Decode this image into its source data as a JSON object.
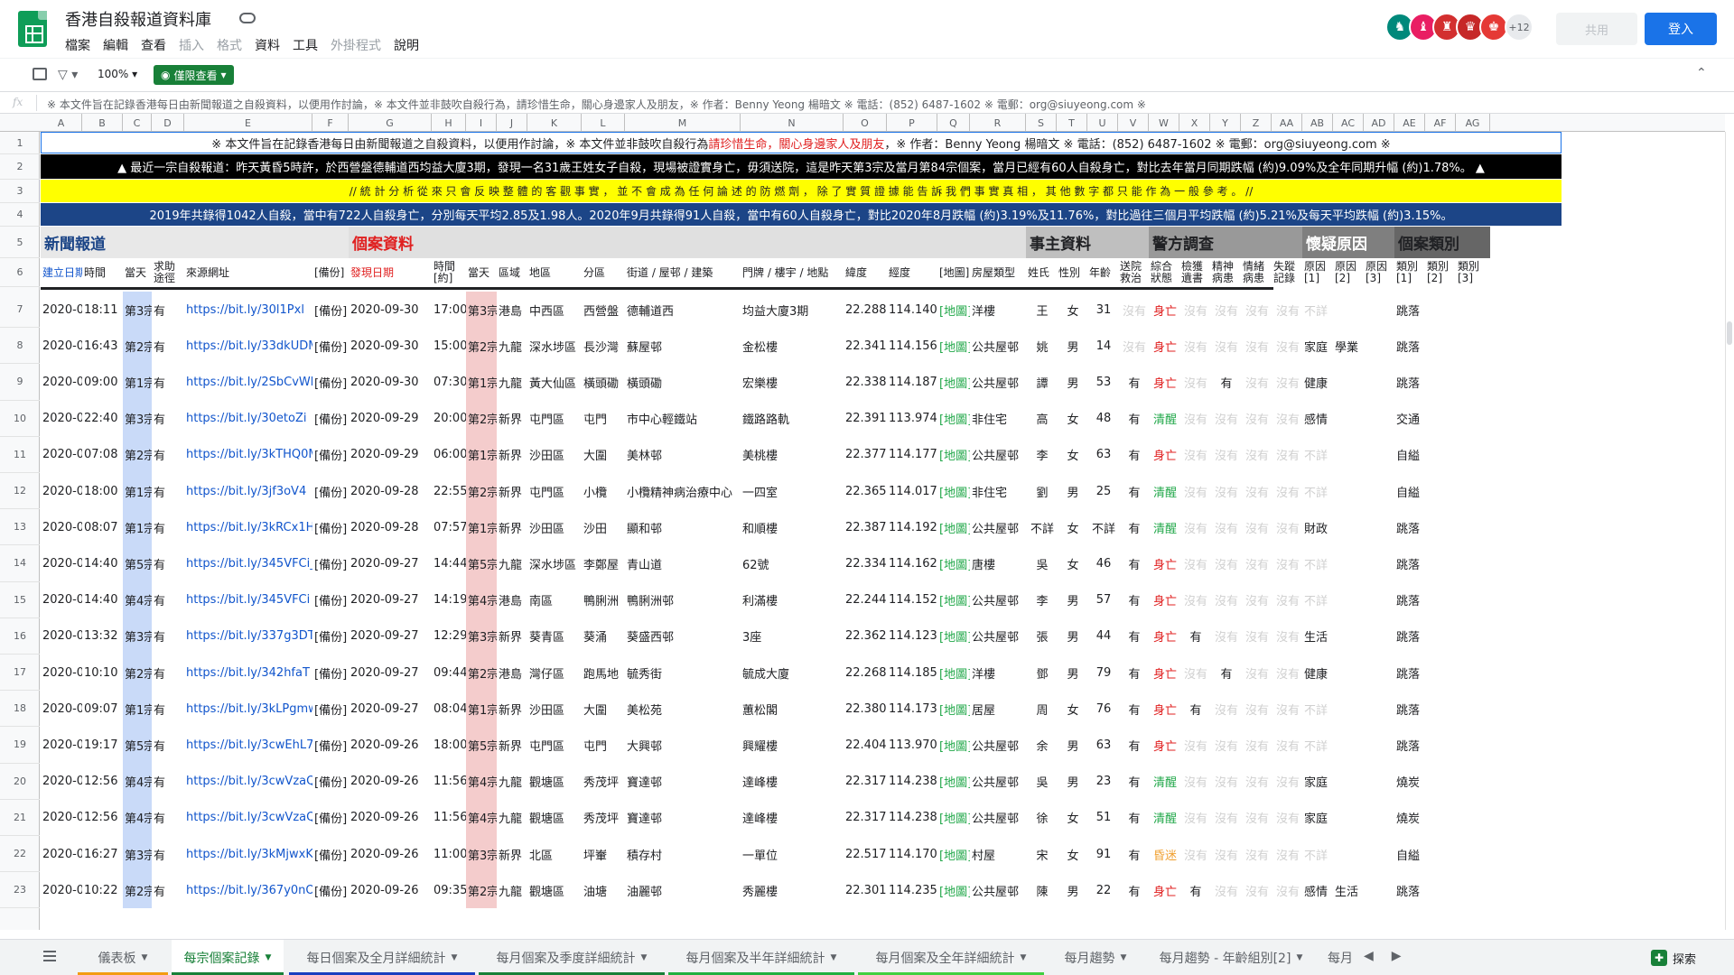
{
  "app": {
    "title": "香港自殺報道資料庫",
    "menu": [
      {
        "label": "檔案",
        "enabled": true
      },
      {
        "label": "編輯",
        "enabled": true
      },
      {
        "label": "查看",
        "enabled": true
      },
      {
        "label": "插入",
        "enabled": false
      },
      {
        "label": "格式",
        "enabled": false
      },
      {
        "label": "資料",
        "enabled": true
      },
      {
        "label": "工具",
        "enabled": true
      },
      {
        "label": "外掛程式",
        "enabled": false
      },
      {
        "label": "說明",
        "enabled": true
      }
    ],
    "collaborators_more": "+12",
    "share_label": "共用",
    "login_label": "登入"
  },
  "toolbar": {
    "zoom": "100%",
    "view_mode": "僅限查看"
  },
  "formula_bar": {
    "icon": "fx",
    "content": "※ 本文件旨在記錄香港每日由新聞報道之自殺資料，以便用作討論，※ 本文件並非鼓吹自殺行為，請珍惜生命，關心身邊家人及朋友，※ 作者：Benny Yeong 楊暗文 ※ 電話：(852) 6487-1602 ※ 電郵：org@siuyeong.com ※"
  },
  "columns": [
    "A",
    "B",
    "C",
    "D",
    "E",
    "F",
    "G",
    "H",
    "I",
    "J",
    "K",
    "L",
    "M",
    "N",
    "O",
    "P",
    "Q",
    "R",
    "S",
    "T",
    "U",
    "V",
    "W",
    "X",
    "Y",
    "Z",
    "AA",
    "AB",
    "AC",
    "AD",
    "AE",
    "AF",
    "AG"
  ],
  "banners": {
    "row1": {
      "a": "※ 本文件旨在記錄香港每日由新聞報道之自殺資料，以便用作討論，※ 本文件並非鼓吹自殺行為 ",
      "b": "請珍惜生命，關心身邊家人及朋友",
      "c": "，※ 作者：Benny Yeong 楊暗文 ※ 電話：(852) 6487-1602 ※ 電郵：org@siuyeong.com ※"
    },
    "row2": "▲ 最近一宗自殺報道：昨天黃昏5時許，於西營盤德輔道西均益大廈3期，發現一名31歲王姓女子自殺，現場被證實身亡，毋須送院，這是昨天第3宗及當月第84宗個案，當月已經有60人自殺身亡，對比去年當月同期跌幅 (約)9.09%及全年同期升幅 (約)1.78%。 ▲",
    "row3": "// 統 計 分 析 從 來 只 會 反 映 整 體 的 客 觀 事 實 ， 並 不 會 成 為 任 何 論 述 的 防 燃 劑 ， 除 了 實 質 證 據 能 告 訴 我 們 事 實 真 相 ， 其 他 數 字 都 只 能 作 為 一 般 參 考 。 //",
    "row4": "2019年共錄得1042人自殺，當中有722人自殺身亡，分別每天平均2.85及1.98人。2020年9月共錄得91人自殺，當中有60人自殺身亡，對比2020年8月跌幅 (約)3.19%及11.76%，對比過往三個月平均跌幅 (約)5.21%及每天平均跌幅 (約)3.15%。"
  },
  "sections": {
    "news": "新聞報道",
    "case": "個案資料",
    "person": "事主資料",
    "police": "警方調查",
    "suspect": "懷疑原因",
    "category": "個案類別"
  },
  "headers": {
    "build_date": "建立日期",
    "time": "時間",
    "day": "當天",
    "help": "求助\n途徑",
    "url": "來源網址",
    "backup": "[備份]",
    "found_date": "發現日期",
    "found_time": "時間\n[約]",
    "day2": "當天",
    "region": "區域",
    "district": "地區",
    "subdistrict": "分區",
    "street": "街道 / 屋邨 / 建築",
    "building": "門牌 / 樓宇 / 地點",
    "lat": "緯度",
    "lng": "經度",
    "map": "[地圖]",
    "housing": "房屋類型",
    "surname": "姓氏",
    "gender": "性別",
    "age": "年齡",
    "rescue": "送院\n救治",
    "status": "綜合\n狀態",
    "record": "檢獲\n遺書",
    "mental": "精神\n病患",
    "emotion": "情緒\n病患",
    "missing": "失蹤\n記錄",
    "reason1": "原因\n[1]",
    "reason2": "原因\n[2]",
    "reason3": "原因\n[3]",
    "cat1": "類別\n[1]",
    "cat2": "類別\n[2]",
    "cat3": "類別\n[3]"
  },
  "rows": [
    {
      "n": "7",
      "date": "2020-09-30",
      "time": "18:11",
      "day": "第3宗",
      "help": "有",
      "url": "https://bit.ly/30l1Pxl",
      "bk": "[備份]",
      "fdate": "2020-09-30",
      "ftime": "17:00",
      "fday": "第3宗",
      "region": "港島",
      "district": "中西區",
      "sub": "西營盤",
      "street": "德輔道西",
      "bldg": "均益大廈3期",
      "lat": "22.2882",
      "lng": "114.1404",
      "map": "[地圖]",
      "house": "洋樓",
      "sur": "王",
      "sex": "女",
      "age": "31",
      "rescue": "沒有",
      "status": "身亡",
      "status_c": "red",
      "note": "沒有",
      "mental": "沒有",
      "emo": "沒有",
      "miss": "沒有",
      "r1": "不詳",
      "r2": "",
      "cat": "跳落"
    },
    {
      "n": "8",
      "date": "2020-09-30",
      "time": "16:43",
      "day": "第2宗",
      "help": "有",
      "url": "https://bit.ly/33dkUDM",
      "bk": "[備份]",
      "fdate": "2020-09-30",
      "ftime": "15:00",
      "fday": "第2宗",
      "region": "九龍",
      "district": "深水埗區",
      "sub": "長沙灣",
      "street": "蘇屋邨",
      "bldg": "金松樓",
      "lat": "22.3414",
      "lng": "114.1560",
      "map": "[地圖]",
      "house": "公共屋邨",
      "sur": "姚",
      "sex": "男",
      "age": "14",
      "rescue": "沒有",
      "status": "身亡",
      "status_c": "red",
      "note": "沒有",
      "mental": "沒有",
      "emo": "沒有",
      "miss": "沒有",
      "r1": "家庭",
      "r2": "學業",
      "cat": "跳落"
    },
    {
      "n": "9",
      "date": "2020-09-30",
      "time": "09:00",
      "day": "第1宗",
      "help": "有",
      "url": "https://bit.ly/2SbCvWb",
      "bk": "[備份]",
      "fdate": "2020-09-30",
      "ftime": "07:30",
      "fday": "第1宗",
      "region": "九龍",
      "district": "黃大仙區",
      "sub": "橫頭磡",
      "street": "橫頭磡",
      "bldg": "宏樂樓",
      "lat": "22.3388",
      "lng": "114.1879",
      "map": "[地圖]",
      "house": "公共屋邨",
      "sur": "譚",
      "sex": "男",
      "age": "53",
      "rescue": "有",
      "status": "身亡",
      "status_c": "red",
      "note": "沒有",
      "mental": "有",
      "emo": "沒有",
      "miss": "沒有",
      "r1": "健康",
      "r2": "",
      "cat": "跳落"
    },
    {
      "n": "10",
      "date": "2020-09-29",
      "time": "22:40",
      "day": "第3宗",
      "help": "有",
      "url": "https://bit.ly/30etoZi",
      "bk": "[備份]",
      "fdate": "2020-09-29",
      "ftime": "20:00",
      "fday": "第2宗",
      "region": "新界",
      "district": "屯門區",
      "sub": "屯門",
      "street": "市中心輕鐵站",
      "bldg": "鐵路路軌",
      "lat": "22.3914",
      "lng": "113.9749",
      "map": "[地圖]",
      "house": "非住宅",
      "sur": "高",
      "sex": "女",
      "age": "48",
      "rescue": "有",
      "status": "清醒",
      "status_c": "green",
      "note": "沒有",
      "mental": "沒有",
      "emo": "沒有",
      "miss": "沒有",
      "r1": "感情",
      "r2": "",
      "cat": "交通"
    },
    {
      "n": "11",
      "date": "2020-09-29",
      "time": "07:08",
      "day": "第2宗",
      "help": "有",
      "url": "https://bit.ly/3kTHQ0M",
      "bk": "[備份]",
      "fdate": "2020-09-29",
      "ftime": "06:00",
      "fday": "第1宗",
      "region": "新界",
      "district": "沙田區",
      "sub": "大圍",
      "street": "美林邨",
      "bldg": "美桃樓",
      "lat": "22.3777",
      "lng": "114.1773",
      "map": "[地圖]",
      "house": "公共屋邨",
      "sur": "李",
      "sex": "女",
      "age": "63",
      "rescue": "有",
      "status": "身亡",
      "status_c": "red",
      "note": "沒有",
      "mental": "沒有",
      "emo": "沒有",
      "miss": "沒有",
      "r1": "不詳",
      "r2": "",
      "cat": "自縊"
    },
    {
      "n": "12",
      "date": "2020-09-29",
      "time": "18:00",
      "day": "第1宗",
      "help": "有",
      "url": "https://bit.ly/3jf3oV4",
      "bk": "[備份]",
      "fdate": "2020-09-28",
      "ftime": "22:55",
      "fday": "第2宗",
      "region": "新界",
      "district": "屯門區",
      "sub": "小欖",
      "street": "小欖精神病治療中心",
      "bldg": "一四室",
      "lat": "22.3654",
      "lng": "114.0172",
      "map": "[地圖]",
      "house": "非住宅",
      "sur": "劉",
      "sex": "男",
      "age": "25",
      "rescue": "有",
      "status": "清醒",
      "status_c": "green",
      "note": "沒有",
      "mental": "沒有",
      "emo": "沒有",
      "miss": "沒有",
      "r1": "不詳",
      "r2": "",
      "cat": "自縊"
    },
    {
      "n": "13",
      "date": "2020-09-28",
      "time": "08:07",
      "day": "第1宗",
      "help": "有",
      "url": "https://bit.ly/3kRCx1H",
      "bk": "[備份]",
      "fdate": "2020-09-28",
      "ftime": "07:57",
      "fday": "第1宗",
      "region": "新界",
      "district": "沙田區",
      "sub": "沙田",
      "street": "顯和邨",
      "bldg": "和順樓",
      "lat": "22.3876",
      "lng": "114.1925",
      "map": "[地圖]",
      "house": "公共屋邨",
      "sur": "不詳",
      "sex": "女",
      "age": "不詳",
      "rescue": "有",
      "status": "清醒",
      "status_c": "green",
      "note": "沒有",
      "mental": "沒有",
      "emo": "沒有",
      "miss": "沒有",
      "r1": "財政",
      "r2": "",
      "cat": "跳落"
    },
    {
      "n": "14",
      "date": "2020-09-27",
      "time": "14:40",
      "day": "第5宗",
      "help": "有",
      "url": "https://bit.ly/345VFCi_2",
      "bk": "[備份]",
      "fdate": "2020-09-27",
      "ftime": "14:44",
      "fday": "第5宗",
      "region": "九龍",
      "district": "深水埗區",
      "sub": "李鄭屋",
      "street": "青山道",
      "bldg": "62號",
      "lat": "22.3342",
      "lng": "114.1621",
      "map": "[地圖]",
      "house": "唐樓",
      "sur": "吳",
      "sex": "女",
      "age": "46",
      "rescue": "有",
      "status": "身亡",
      "status_c": "red",
      "note": "沒有",
      "mental": "沒有",
      "emo": "沒有",
      "miss": "沒有",
      "r1": "不詳",
      "r2": "",
      "cat": "跳落"
    },
    {
      "n": "15",
      "date": "2020-09-27",
      "time": "14:40",
      "day": "第4宗",
      "help": "有",
      "url": "https://bit.ly/345VFCi",
      "bk": "[備份]",
      "fdate": "2020-09-27",
      "ftime": "14:19",
      "fday": "第4宗",
      "region": "港島",
      "district": "南區",
      "sub": "鴨脷洲",
      "street": "鴨脷洲邨",
      "bldg": "利滿樓",
      "lat": "22.2444",
      "lng": "114.1521",
      "map": "[地圖]",
      "house": "公共屋邨",
      "sur": "李",
      "sex": "男",
      "age": "57",
      "rescue": "有",
      "status": "身亡",
      "status_c": "red",
      "note": "沒有",
      "mental": "沒有",
      "emo": "沒有",
      "miss": "沒有",
      "r1": "不詳",
      "r2": "",
      "cat": "跳落"
    },
    {
      "n": "16",
      "date": "2020-09-27",
      "time": "13:32",
      "day": "第3宗",
      "help": "有",
      "url": "https://bit.ly/337g3DT",
      "bk": "[備份]",
      "fdate": "2020-09-27",
      "ftime": "12:29",
      "fday": "第3宗",
      "region": "新界",
      "district": "葵青區",
      "sub": "葵涌",
      "street": "葵盛西邨",
      "bldg": "3座",
      "lat": "22.3626",
      "lng": "114.1236",
      "map": "[地圖]",
      "house": "公共屋邨",
      "sur": "張",
      "sex": "男",
      "age": "44",
      "rescue": "有",
      "status": "身亡",
      "status_c": "red",
      "note": "有",
      "mental": "沒有",
      "emo": "沒有",
      "miss": "沒有",
      "r1": "生活",
      "r2": "",
      "cat": "跳落"
    },
    {
      "n": "17",
      "date": "2020-09-27",
      "time": "10:10",
      "day": "第2宗",
      "help": "有",
      "url": "https://bit.ly/342hfaT",
      "bk": "[備份]",
      "fdate": "2020-09-27",
      "ftime": "09:44",
      "fday": "第2宗",
      "region": "港島",
      "district": "灣仔區",
      "sub": "跑馬地",
      "street": "毓秀街",
      "bldg": "毓成大廈",
      "lat": "22.2686",
      "lng": "114.1859",
      "map": "[地圖]",
      "house": "洋樓",
      "sur": "鄧",
      "sex": "男",
      "age": "79",
      "rescue": "有",
      "status": "身亡",
      "status_c": "red",
      "note": "沒有",
      "mental": "有",
      "emo": "沒有",
      "miss": "沒有",
      "r1": "健康",
      "r2": "",
      "cat": "跳落"
    },
    {
      "n": "18",
      "date": "2020-09-27",
      "time": "09:07",
      "day": "第1宗",
      "help": "有",
      "url": "https://bit.ly/3kLPgmw",
      "bk": "[備份]",
      "fdate": "2020-09-27",
      "ftime": "08:04",
      "fday": "第1宗",
      "region": "新界",
      "district": "沙田區",
      "sub": "大圍",
      "street": "美松苑",
      "bldg": "蕙松閣",
      "lat": "22.3805",
      "lng": "114.1737",
      "map": "[地圖]",
      "house": "居屋",
      "sur": "周",
      "sex": "女",
      "age": "76",
      "rescue": "有",
      "status": "身亡",
      "status_c": "red",
      "note": "有",
      "mental": "沒有",
      "emo": "沒有",
      "miss": "沒有",
      "r1": "不詳",
      "r2": "",
      "cat": "跳落"
    },
    {
      "n": "19",
      "date": "2020-09-26",
      "time": "19:17",
      "day": "第5宗",
      "help": "有",
      "url": "https://bit.ly/3cwEhL7",
      "bk": "[備份]",
      "fdate": "2020-09-26",
      "ftime": "18:00",
      "fday": "第5宗",
      "region": "新界",
      "district": "屯門區",
      "sub": "屯門",
      "street": "大興邨",
      "bldg": "興耀樓",
      "lat": "22.4045",
      "lng": "113.9709",
      "map": "[地圖]",
      "house": "公共屋邨",
      "sur": "余",
      "sex": "男",
      "age": "63",
      "rescue": "有",
      "status": "身亡",
      "status_c": "red",
      "note": "沒有",
      "mental": "沒有",
      "emo": "沒有",
      "miss": "沒有",
      "r1": "不詳",
      "r2": "",
      "cat": "跳落"
    },
    {
      "n": "20",
      "date": "2020-09-26",
      "time": "12:56",
      "day": "第4宗",
      "help": "有",
      "url": "https://bit.ly/3cwVzaQ",
      "bk": "[備份]",
      "fdate": "2020-09-26",
      "ftime": "11:56",
      "fday": "第4宗",
      "region": "九龍",
      "district": "觀塘區",
      "sub": "秀茂坪",
      "street": "寶達邨",
      "bldg": "達峰樓",
      "lat": "22.3172",
      "lng": "114.2381",
      "map": "[地圖]",
      "house": "公共屋邨",
      "sur": "吳",
      "sex": "男",
      "age": "23",
      "rescue": "有",
      "status": "清醒",
      "status_c": "green",
      "note": "沒有",
      "mental": "沒有",
      "emo": "沒有",
      "miss": "沒有",
      "r1": "家庭",
      "r2": "",
      "cat": "燒炭"
    },
    {
      "n": "21",
      "date": "2020-09-26",
      "time": "12:56",
      "day": "第4宗",
      "help": "有",
      "url": "https://bit.ly/3cwVzaQ",
      "bk": "[備份]",
      "fdate": "2020-09-26",
      "ftime": "11:56",
      "fday": "第4宗",
      "region": "九龍",
      "district": "觀塘區",
      "sub": "秀茂坪",
      "street": "寶達邨",
      "bldg": "達峰樓",
      "lat": "22.3172",
      "lng": "114.2381",
      "map": "[地圖]",
      "house": "公共屋邨",
      "sur": "徐",
      "sex": "女",
      "age": "51",
      "rescue": "有",
      "status": "清醒",
      "status_c": "green",
      "note": "沒有",
      "mental": "沒有",
      "emo": "沒有",
      "miss": "沒有",
      "r1": "家庭",
      "r2": "",
      "cat": "燒炭"
    },
    {
      "n": "22",
      "date": "2020-09-26",
      "time": "16:27",
      "day": "第3宗",
      "help": "有",
      "url": "https://bit.ly/3kMjwxK",
      "bk": "[備份]",
      "fdate": "2020-09-26",
      "ftime": "11:00",
      "fday": "第3宗",
      "region": "新界",
      "district": "北區",
      "sub": "坪輋",
      "street": "積存村",
      "bldg": "一單位",
      "lat": "22.5176",
      "lng": "114.1709",
      "map": "[地圖]",
      "house": "村屋",
      "sur": "宋",
      "sex": "女",
      "age": "91",
      "rescue": "有",
      "status": "昏迷",
      "status_c": "orange",
      "note": "沒有",
      "mental": "沒有",
      "emo": "沒有",
      "miss": "沒有",
      "r1": "不詳",
      "r2": "",
      "cat": "自縊"
    },
    {
      "n": "23",
      "date": "2020-09-26",
      "time": "10:22",
      "day": "第2宗",
      "help": "有",
      "url": "https://bit.ly/367y0nO",
      "bk": "[備份]",
      "fdate": "2020-09-26",
      "ftime": "09:35",
      "fday": "第2宗",
      "region": "九龍",
      "district": "觀塘區",
      "sub": "油塘",
      "street": "油麗邨",
      "bldg": "秀麗樓",
      "lat": "22.3015",
      "lng": "114.2359",
      "map": "[地圖]",
      "house": "公共屋邨",
      "sur": "陳",
      "sex": "男",
      "age": "22",
      "rescue": "有",
      "status": "身亡",
      "status_c": "red",
      "note": "有",
      "mental": "沒有",
      "emo": "沒有",
      "miss": "沒有",
      "r1": "感情",
      "r2": "生活",
      "cat": "跳落"
    }
  ],
  "tabs": [
    {
      "label": "儀表板",
      "color": "#f39c12",
      "active": false
    },
    {
      "label": "每宗個案記錄",
      "color": "#188038",
      "active": true
    },
    {
      "label": "每日個案及全月詳細統計",
      "color": "#1a3fc0",
      "active": false
    },
    {
      "label": "每月個案及季度詳細統計",
      "color": "#188038",
      "active": false
    },
    {
      "label": "每月個案及半年詳細統計",
      "color": "#20b040",
      "active": false
    },
    {
      "label": "每月個案及全年詳細統計",
      "color": "#40d040",
      "active": false
    },
    {
      "label": "每月趨勢",
      "color": "",
      "active": false
    },
    {
      "label": "每月趨勢 - 年齡組別[2]",
      "color": "",
      "active": false
    },
    {
      "label": "每月",
      "color": "",
      "active": false
    }
  ],
  "explore_label": "探索"
}
